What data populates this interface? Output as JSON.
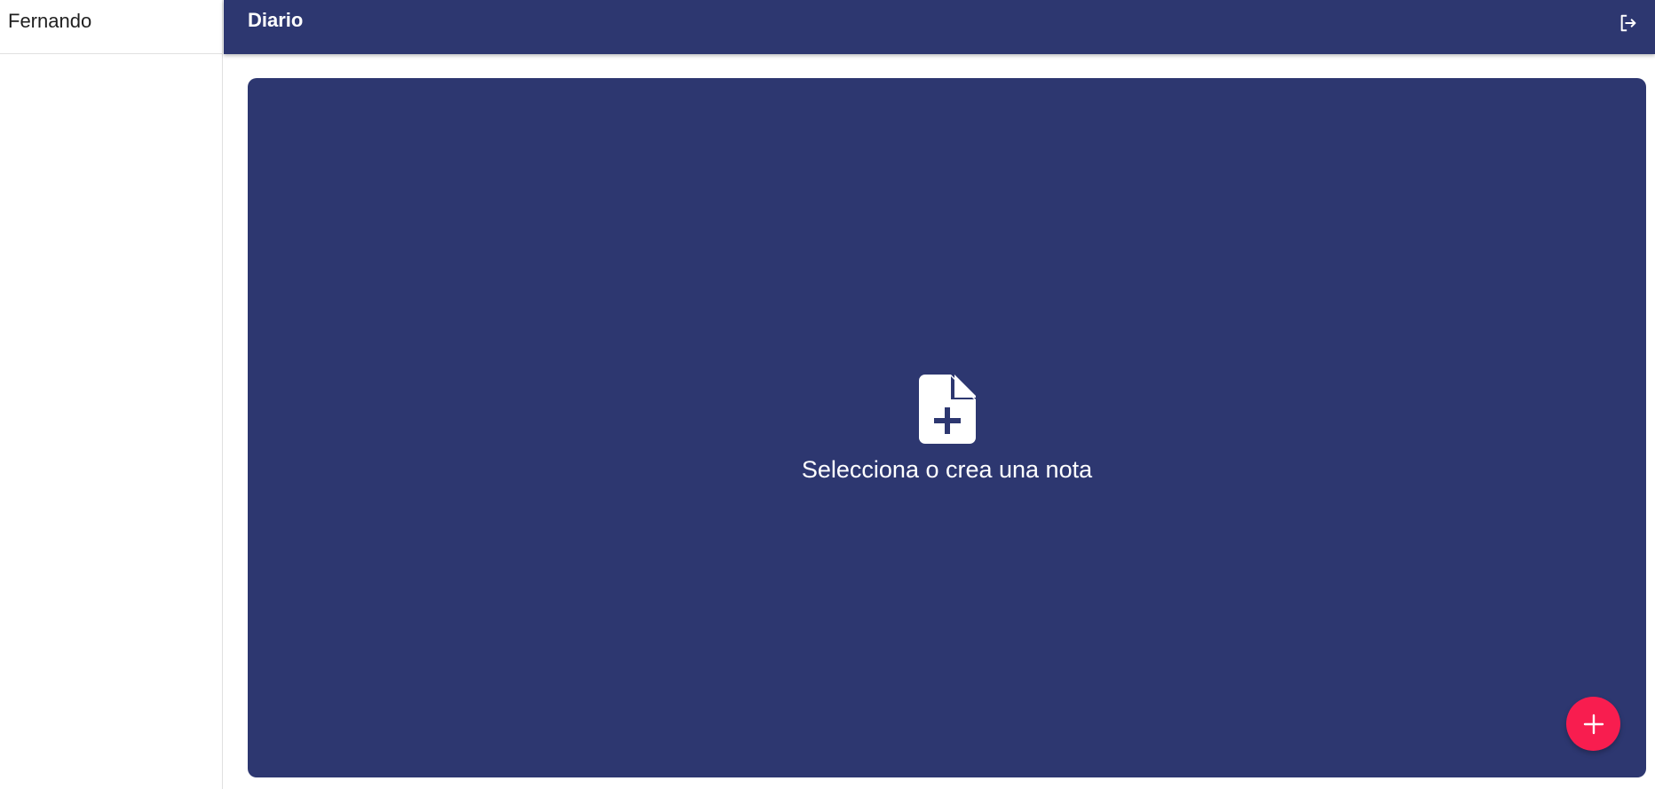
{
  "sidebar": {
    "user_name": "Fernando"
  },
  "appbar": {
    "title": "Diario",
    "logout_icon": "logout-icon"
  },
  "main": {
    "empty_state": {
      "icon": "note-add-icon",
      "message": "Selecciona o crea una nota"
    }
  },
  "fab": {
    "icon": "plus-icon"
  },
  "colors": {
    "primary": "#2d3770",
    "accent": "#f81d4f",
    "background": "#ffffff",
    "text_light": "#ffffff",
    "text_dark": "#1f1f1f"
  }
}
